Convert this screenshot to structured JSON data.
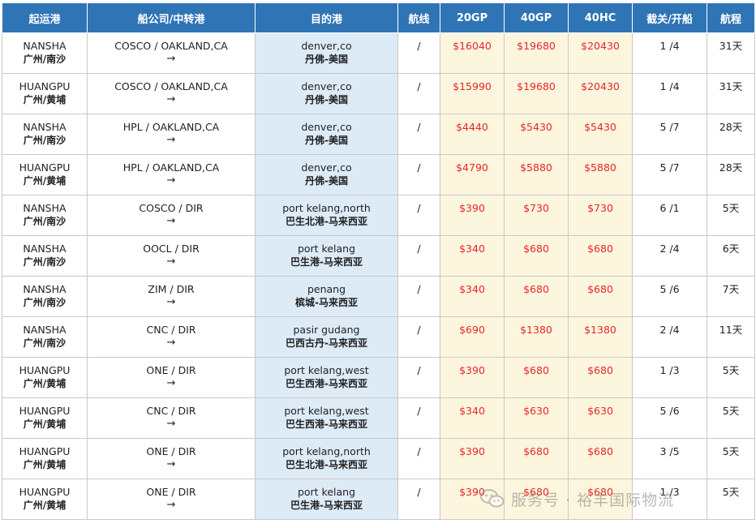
{
  "headers": [
    "起运港",
    "船公司/中转港",
    "目的港",
    "航线",
    "20GP",
    "40GP",
    "40HC",
    "截关/开船",
    "航程"
  ],
  "rows": [
    {
      "origin_en": "NANSHA",
      "origin_cn": "广州/南沙",
      "carrier": "COSCO / OAKLAND,CA",
      "arrow": "→",
      "dest_en": "denver,co",
      "dest_cn": "丹佛-美国",
      "route": "/",
      "gp20": "$16040",
      "gp40": "$19680",
      "hc40": "$20430",
      "schedule": "1 /4",
      "transit": "31天"
    },
    {
      "origin_en": "HUANGPU",
      "origin_cn": "广州/黄埔",
      "carrier": "COSCO / OAKLAND,CA",
      "arrow": "→",
      "dest_en": "denver,co",
      "dest_cn": "丹佛-美国",
      "route": "/",
      "gp20": "$15990",
      "gp40": "$19680",
      "hc40": "$20430",
      "schedule": "1 /4",
      "transit": "31天"
    },
    {
      "origin_en": "NANSHA",
      "origin_cn": "广州/南沙",
      "carrier": "HPL / OAKLAND,CA",
      "arrow": "→",
      "dest_en": "denver,co",
      "dest_cn": "丹佛-美国",
      "route": "/",
      "gp20": "$4440",
      "gp40": "$5430",
      "hc40": "$5430",
      "schedule": "5 /7",
      "transit": "28天"
    },
    {
      "origin_en": "HUANGPU",
      "origin_cn": "广州/黄埔",
      "carrier": "HPL / OAKLAND,CA",
      "arrow": "→",
      "dest_en": "denver,co",
      "dest_cn": "丹佛-美国",
      "route": "/",
      "gp20": "$4790",
      "gp40": "$5880",
      "hc40": "$5880",
      "schedule": "5 /7",
      "transit": "28天"
    },
    {
      "origin_en": "NANSHA",
      "origin_cn": "广州/南沙",
      "carrier": "COSCO / DIR",
      "arrow": "→",
      "dest_en": "port kelang,north",
      "dest_cn": "巴生北港-马来西亚",
      "route": "/",
      "gp20": "$390",
      "gp40": "$730",
      "hc40": "$730",
      "schedule": "6 /1",
      "transit": "5天"
    },
    {
      "origin_en": "NANSHA",
      "origin_cn": "广州/南沙",
      "carrier": "OOCL / DIR",
      "arrow": "→",
      "dest_en": "port kelang",
      "dest_cn": "巴生港-马来西亚",
      "route": "/",
      "gp20": "$340",
      "gp40": "$680",
      "hc40": "$680",
      "schedule": "2 /4",
      "transit": "6天"
    },
    {
      "origin_en": "NANSHA",
      "origin_cn": "广州/南沙",
      "carrier": "ZIM / DIR",
      "arrow": "→",
      "dest_en": "penang",
      "dest_cn": "槟城-马来西亚",
      "route": "/",
      "gp20": "$340",
      "gp40": "$680",
      "hc40": "$680",
      "schedule": "5 /6",
      "transit": "7天"
    },
    {
      "origin_en": "NANSHA",
      "origin_cn": "广州/南沙",
      "carrier": "CNC / DIR",
      "arrow": "→",
      "dest_en": "pasir gudang",
      "dest_cn": "巴西古丹-马来西亚",
      "route": "/",
      "gp20": "$690",
      "gp40": "$1380",
      "hc40": "$1380",
      "schedule": "2 /4",
      "transit": "11天"
    },
    {
      "origin_en": "HUANGPU",
      "origin_cn": "广州/黄埔",
      "carrier": "ONE / DIR",
      "arrow": "→",
      "dest_en": "port kelang,west",
      "dest_cn": "巴生西港-马来西亚",
      "route": "/",
      "gp20": "$390",
      "gp40": "$680",
      "hc40": "$680",
      "schedule": "1 /3",
      "transit": "5天"
    },
    {
      "origin_en": "HUANGPU",
      "origin_cn": "广州/黄埔",
      "carrier": "CNC / DIR",
      "arrow": "→",
      "dest_en": "port kelang,west",
      "dest_cn": "巴生西港-马来西亚",
      "route": "/",
      "gp20": "$340",
      "gp40": "$630",
      "hc40": "$630",
      "schedule": "5 /6",
      "transit": "5天"
    },
    {
      "origin_en": "HUANGPU",
      "origin_cn": "广州/黄埔",
      "carrier": "ONE / DIR",
      "arrow": "→",
      "dest_en": "port kelang,north",
      "dest_cn": "巴生北港-马来西亚",
      "route": "/",
      "gp20": "$390",
      "gp40": "$680",
      "hc40": "$680",
      "schedule": "3 /5",
      "transit": "5天"
    },
    {
      "origin_en": "HUANGPU",
      "origin_cn": "广州/黄埔",
      "carrier": "ONE / DIR",
      "arrow": "→",
      "dest_en": "port kelang",
      "dest_cn": "巴生港-马来西亚",
      "route": "/",
      "gp20": "$390",
      "gp40": "$680",
      "hc40": "$680",
      "schedule": "1 /3",
      "transit": "5天"
    }
  ],
  "watermark": "服务号 · 裕丰国际物流",
  "colors": {
    "header_bg": "#2f74b5",
    "destination_bg": "#ddebf7",
    "price_bg": "#fdf6de",
    "price_text": "#e8262a"
  }
}
